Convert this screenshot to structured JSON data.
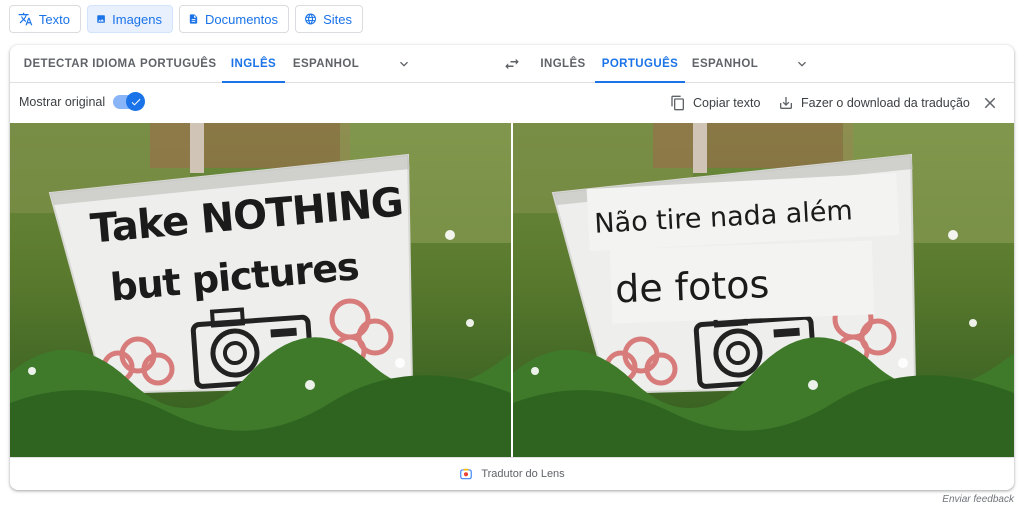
{
  "modes": [
    {
      "label": "Texto",
      "icon": "translate-icon"
    },
    {
      "label": "Imagens",
      "icon": "image-icon"
    },
    {
      "label": "Documentos",
      "icon": "document-icon"
    },
    {
      "label": "Sites",
      "icon": "globe-icon"
    }
  ],
  "source_langs": [
    "DETECTAR IDIOMA",
    "PORTUGUÊS",
    "INGLÊS",
    "ESPANHOL"
  ],
  "target_langs": [
    "INGLÊS",
    "PORTUGUÊS",
    "ESPANHOL"
  ],
  "toolbar": {
    "show_original": "Mostrar original",
    "copy_text": "Copiar texto",
    "download": "Fazer o download da tradução"
  },
  "image": {
    "original_line1": "Take NOTHING",
    "original_line2": "but pictures",
    "translated_line1": "Não tire nada além",
    "translated_line2": "de fotos"
  },
  "footer": {
    "label": "Tradutor do Lens"
  },
  "feedback": "Enviar feedback",
  "colors": {
    "accent": "#1a73e8",
    "active_bg": "#e8f0fe"
  }
}
